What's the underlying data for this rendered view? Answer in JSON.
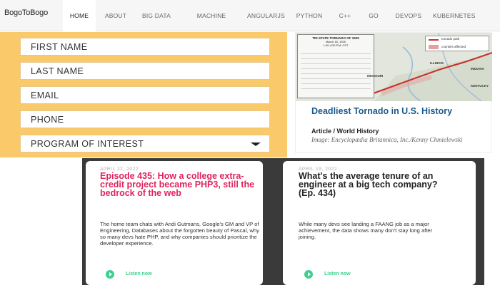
{
  "nav": {
    "brand": "BogoToBogo",
    "items": [
      {
        "label": "HOME",
        "active": true
      },
      {
        "label": "ABOUT",
        "active": false
      },
      {
        "label": "BIG DATA",
        "active": false
      },
      {
        "label": "MACHINE LEARNING",
        "active": false
      },
      {
        "label": "ANGULARJS",
        "active": false
      },
      {
        "label": "PYTHON",
        "active": false
      },
      {
        "label": "C++",
        "active": false
      },
      {
        "label": "GO",
        "active": false
      },
      {
        "label": "DEVOPS",
        "active": false
      },
      {
        "label": "KUBERNETES",
        "active": false
      }
    ]
  },
  "form": {
    "background_color": "#f9c96a",
    "first_name": "FIRST NAME",
    "last_name": "LAST NAME",
    "email": "EMAIL",
    "phone": "PHONE",
    "program": "PROGRAM OF INTEREST"
  },
  "tornado_card": {
    "map_title": "TRI-STATE TORNADO OF 1925",
    "map_subtitle": "March 18, 1925",
    "map_time": "1:00-4:30 P.M. CST",
    "legend_path": "tornado path",
    "legend_counties": "counties affected",
    "states": [
      "MISSOURI",
      "ILLINOIS",
      "INDIANA",
      "KENTUCKY"
    ],
    "title": "Deadliest Tornado in U.S. History",
    "meta": "Article / World History",
    "credit": "Image: Encyclopædia Britannica, Inc./Kenny Chmielewski",
    "title_color": "#1a5a8c"
  },
  "episodes": [
    {
      "date": "APRIL 22, 2022",
      "title": "Episode 435: How a college extra-credit project became PHP3, still the bedrock of the web",
      "description": "The home team chats with Andi Gutmans, Google's GM and VP of Engineering, Databases about the forgotten beauty of Pascal, why so many devs hate PHP, and why companies should prioritize the developer experience.",
      "listen": "Listen now",
      "title_color": "#e0245e"
    },
    {
      "date": "APRIL 19, 2022",
      "title": "What's the average tenure of an engineer at a big tech company? (Ep. 434)",
      "description": "While many devs see landing a FAANG job as a major achievement, the data shows many don't stay long after joining.",
      "listen": "Listen now",
      "title_color": "#222222"
    }
  ]
}
